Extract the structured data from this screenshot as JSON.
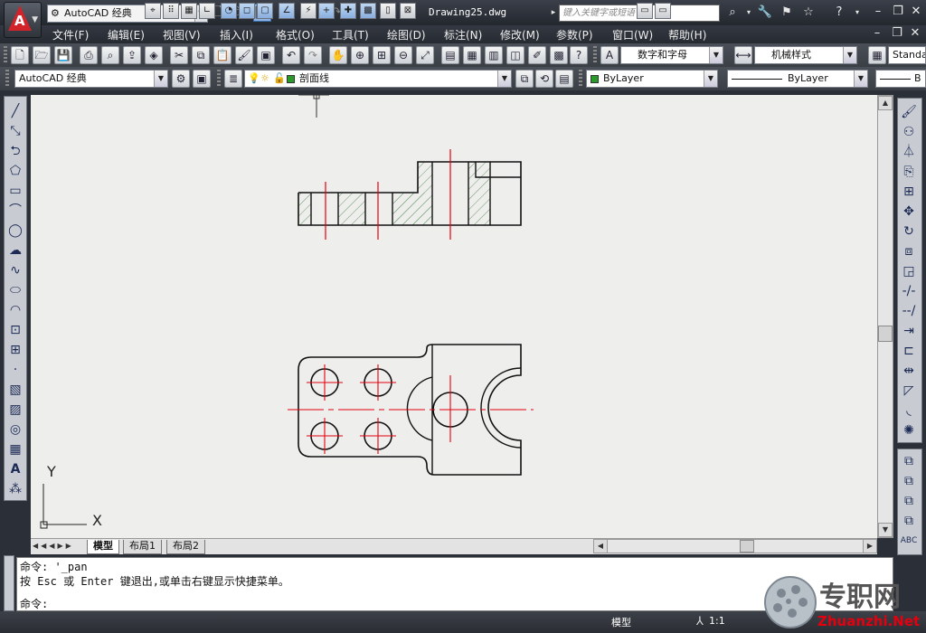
{
  "app": {
    "workspace_label": "AutoCAD 经典",
    "document_title": "Drawing25.dwg",
    "search_placeholder": "键入关键字或短语"
  },
  "menu": [
    "文件(F)",
    "编辑(E)",
    "视图(V)",
    "插入(I)",
    "格式(O)",
    "工具(T)",
    "绘图(D)",
    "标注(N)",
    "修改(M)",
    "参数(P)",
    "窗口(W)",
    "帮助(H)"
  ],
  "styles": {
    "text_style": "数字和字母",
    "dim_style": "机械样式",
    "table_style": "Standa"
  },
  "workspace_combo": "AutoCAD 经典",
  "layer_combo": "剖面线",
  "properties": {
    "color": "ByLayer",
    "linetype": "ByLayer",
    "lineweight": "B"
  },
  "tabs": [
    "模型",
    "布局1",
    "布局2"
  ],
  "command": {
    "line1": "命令: '_pan",
    "line2": "按 Esc 或 Enter 键退出,或单击右键显示快捷菜单。",
    "prompt": "命令:"
  },
  "status": {
    "model_label": "模型",
    "scale": "1:1"
  },
  "ucs": {
    "x_label": "X",
    "y_label": "Y"
  },
  "watermark": {
    "text_cn": "专职网",
    "text_en": "Zhuanzhi.Net"
  },
  "colors": {
    "accent_red": "#e4000f",
    "hatch": "#6c9a6c",
    "canvas_bg": "#eeeeec"
  }
}
